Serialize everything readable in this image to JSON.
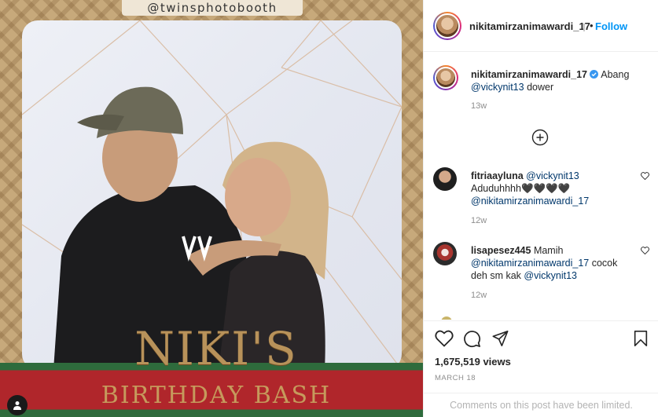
{
  "photo": {
    "watermark": "@twinsphotobooth",
    "title_line1": "NIKI'S",
    "title_line2": "BIRTHDAY BASH"
  },
  "header": {
    "username": "nikitamirzanimawardi_17",
    "separator": "•",
    "follow_label": "Follow",
    "more_label": "···"
  },
  "comments": [
    {
      "username": "nikitamirzanimawardi_17",
      "verified": true,
      "text_before": "Abang",
      "mention": "@vickynit13",
      "text_after": "dower",
      "time": "13w"
    },
    {
      "username": "fitriaayluna",
      "mention": "@vickynit13",
      "text": "Aduduhhhh🖤🖤🖤🖤",
      "mention2": "@nikitamirzanimawardi_17",
      "time": "12w"
    },
    {
      "username": "lisapesez445",
      "text_before": "Mamih",
      "mention": "@nikitamirzanimawardi_17",
      "text_mid": "cocok deh sm kak",
      "mention2": "@vickynit13",
      "time": "12w"
    }
  ],
  "stats": {
    "views": "1,675,519 views",
    "date": "MARCH 18"
  },
  "footer": {
    "limited_text": "Comments on this post have been limited."
  },
  "icons": {
    "like": "heart-icon",
    "comment": "comment-icon",
    "share": "share-icon",
    "save": "bookmark-icon",
    "load_more": "plus-circle-icon",
    "user_tags": "user-icon"
  },
  "colors": {
    "accent": "#0095f6",
    "link": "#00376b",
    "muted": "#8e8e8e",
    "verified": "#3897f0"
  }
}
